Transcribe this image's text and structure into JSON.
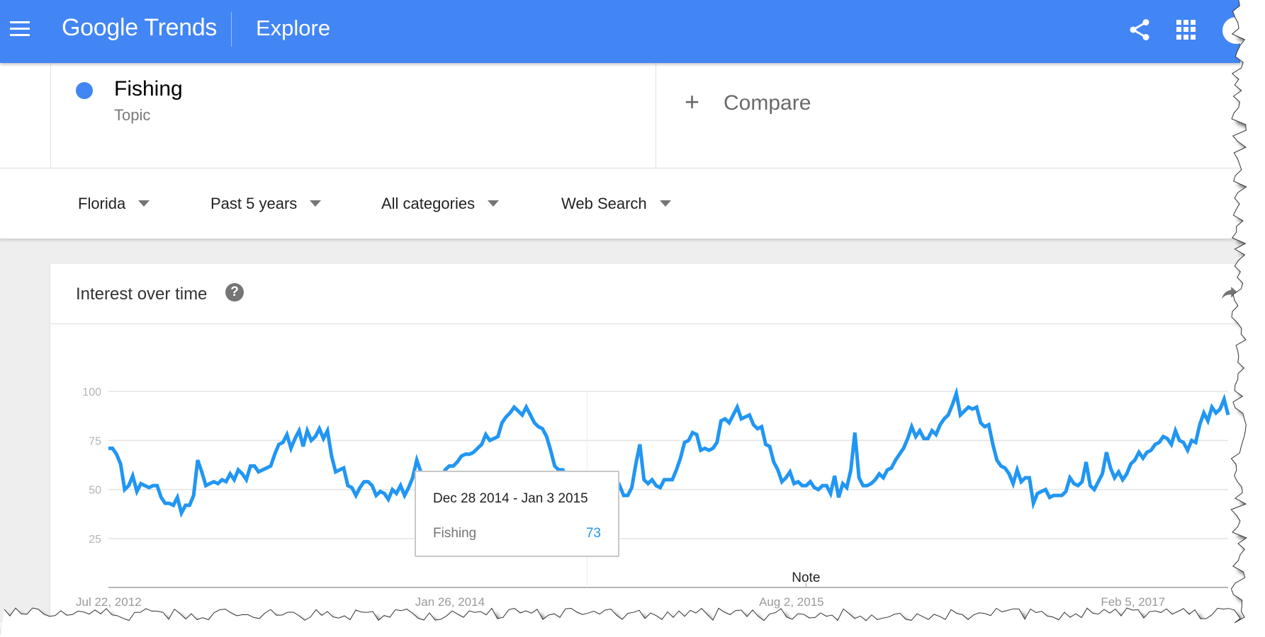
{
  "header": {
    "logo": "Google Trends",
    "page_title": "Explore",
    "icons": [
      "menu-icon",
      "share-icon",
      "apps-icon",
      "account-avatar"
    ],
    "brand_color": "#4285f4"
  },
  "search": {
    "term": "Fishing",
    "term_type": "Topic",
    "term_color": "#4285f4",
    "compare_label": "Compare",
    "compare_icon": "plus-icon"
  },
  "filters": [
    {
      "label": "Florida"
    },
    {
      "label": "Past 5 years"
    },
    {
      "label": "All categories"
    },
    {
      "label": "Web Search"
    }
  ],
  "card": {
    "title": "Interest over time",
    "help_icon_glyph": "?",
    "embed_icon": "share-arrow-icon"
  },
  "tooltip": {
    "date": "Dec 28 2014 - Jan 3 2015",
    "series": "Fishing",
    "value": "73"
  },
  "chart_data": {
    "type": "line",
    "title": "Interest over time",
    "xlabel": "",
    "ylabel": "",
    "ylim": [
      0,
      100
    ],
    "yticks": [
      25,
      50,
      75,
      100
    ],
    "x_tick_labels": [
      "Jul 22, 2012",
      "Jan 26, 2014",
      "Aug 2, 2015",
      "Feb 5, 2017"
    ],
    "annotation": "Note",
    "grid": true,
    "line_color": "#2196f3",
    "highlighted_point": {
      "label": "Dec 28 2014 - Jan 3 2015",
      "value": 73
    },
    "series": [
      {
        "name": "Fishing",
        "values": [
          71,
          71,
          68,
          63,
          50,
          52,
          57,
          49,
          53,
          52,
          51,
          52,
          52,
          46,
          43,
          43,
          42,
          46,
          38,
          42,
          42,
          47,
          65,
          59,
          52,
          53,
          54,
          53,
          55,
          54,
          58,
          55,
          60,
          58,
          55,
          62,
          62,
          59,
          60,
          61,
          62,
          68,
          73,
          74,
          78,
          71,
          76,
          80,
          72,
          80,
          75,
          77,
          81,
          76,
          80,
          67,
          59,
          60,
          61,
          52,
          51,
          47,
          51,
          54,
          54,
          52,
          47,
          49,
          48,
          45,
          50,
          48,
          52,
          47,
          51,
          56,
          65,
          59,
          51,
          52,
          51,
          55,
          55,
          60,
          62,
          62,
          64,
          67,
          68,
          68,
          69,
          71,
          73,
          78,
          75,
          76,
          77,
          84,
          87,
          89,
          92,
          90,
          88,
          92,
          88,
          84,
          82,
          81,
          77,
          70,
          62,
          60,
          60,
          55,
          53,
          54,
          52,
          52,
          50,
          49,
          47,
          49,
          52,
          46,
          50,
          49,
          52,
          47,
          47,
          51,
          63,
          73,
          55,
          53,
          55,
          52,
          51,
          55,
          55,
          55,
          60,
          66,
          74,
          75,
          79,
          78,
          70,
          71,
          70,
          71,
          74,
          85,
          86,
          84,
          88,
          92,
          86,
          87,
          88,
          83,
          81,
          82,
          73,
          72,
          64,
          60,
          54,
          56,
          59,
          53,
          54,
          52,
          52,
          54,
          51,
          50,
          52,
          52,
          48,
          57,
          46,
          53,
          51,
          60,
          79,
          56,
          52,
          52,
          53,
          55,
          58,
          56,
          60,
          61,
          65,
          68,
          71,
          76,
          82,
          77,
          80,
          76,
          76,
          80,
          78,
          83,
          86,
          88,
          93,
          99,
          88,
          90,
          92,
          91,
          92,
          84,
          82,
          83,
          73,
          65,
          62,
          61,
          58,
          53,
          60,
          54,
          56,
          56,
          43,
          48,
          49,
          50,
          46,
          47,
          47,
          47,
          49,
          56,
          53,
          52,
          54,
          64,
          52,
          50,
          54,
          58,
          69,
          61,
          56,
          59,
          55,
          58,
          63,
          65,
          69,
          66,
          69,
          70,
          73,
          74,
          77,
          76,
          73,
          80,
          75,
          74,
          70,
          75,
          74,
          83,
          89,
          85,
          92,
          89,
          91,
          96,
          88
        ]
      }
    ]
  }
}
